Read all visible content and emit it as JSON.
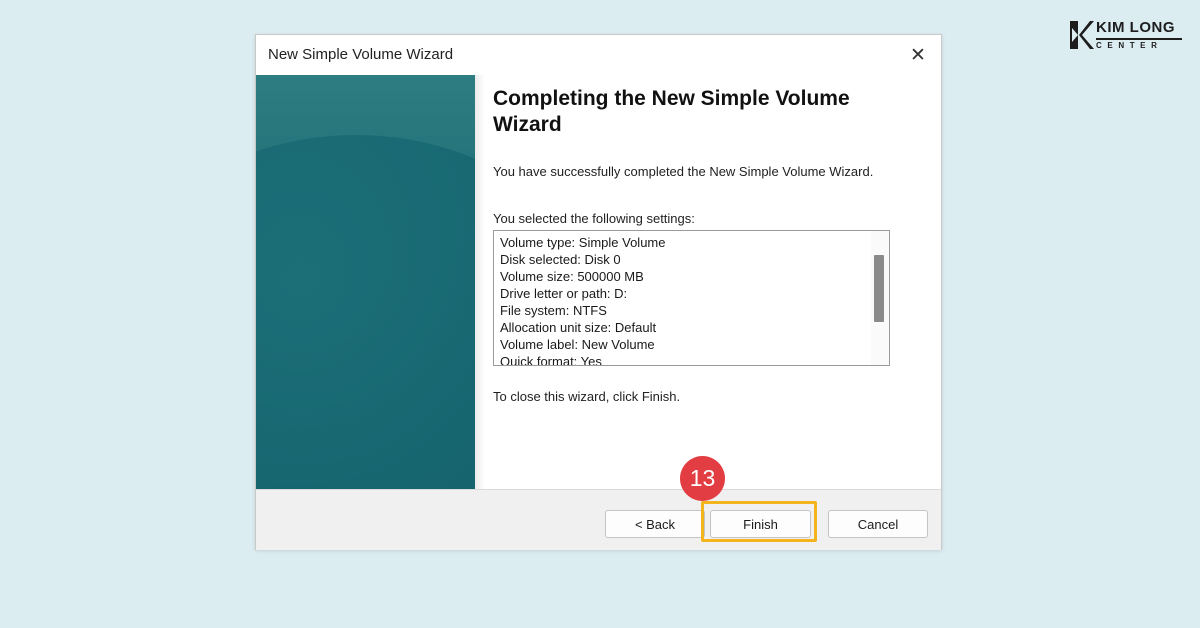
{
  "brand": {
    "top": "KIM LONG",
    "bottom": "CENTER",
    "color": "#1d1d1d"
  },
  "window": {
    "title": "New Simple Volume Wizard",
    "close_glyph": "✕"
  },
  "content": {
    "heading": "Completing the New Simple Volume Wizard",
    "description": "You have successfully completed the New Simple Volume Wizard.",
    "settings_label": "You selected the following settings:",
    "settings": [
      "Volume type: Simple Volume",
      "Disk selected: Disk 0",
      "Volume size: 500000 MB",
      "Drive letter or path: D:",
      "File system: NTFS",
      "Allocation unit size: Default",
      "Volume label: New Volume",
      "Quick format: Yes"
    ],
    "closing_text": "To close this wizard, click Finish."
  },
  "footer": {
    "back_label": "< Back",
    "finish_label": "Finish",
    "cancel_label": "Cancel"
  },
  "annotation": {
    "step_number": "13",
    "badge_color": "#e23d43",
    "highlight_color": "#f3b41d"
  },
  "colors": {
    "background": "#dcedf2",
    "banner": "#1e6e76"
  }
}
